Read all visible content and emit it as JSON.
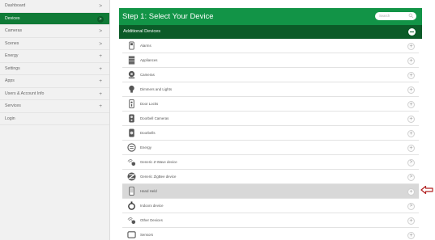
{
  "sidebar": {
    "items": [
      {
        "label": "Dashboard",
        "symbol": ">",
        "active": false
      },
      {
        "label": "Devices",
        "symbol": ">",
        "active": true
      },
      {
        "label": "Cameras",
        "symbol": ">",
        "active": false
      },
      {
        "label": "Scenes",
        "symbol": ">",
        "active": false
      },
      {
        "label": "Energy",
        "symbol": "+",
        "active": false
      },
      {
        "label": "Settings",
        "symbol": "+",
        "active": false
      },
      {
        "label": "Apps",
        "symbol": "+",
        "active": false
      },
      {
        "label": "Users & Account Info",
        "symbol": "+",
        "active": false
      },
      {
        "label": "Services",
        "symbol": "+",
        "active": false
      },
      {
        "label": "Login",
        "symbol": "",
        "active": false
      }
    ]
  },
  "header": {
    "step_title": "Step 1: Select Your Device",
    "search_placeholder": "Search"
  },
  "section": {
    "title": "Additional Devices"
  },
  "devices": [
    {
      "label": "Alarms",
      "icon": "alarm-icon",
      "action": "+",
      "highlight": false
    },
    {
      "label": "Appliances",
      "icon": "appliance-icon",
      "action": "+",
      "highlight": false
    },
    {
      "label": "Cameras",
      "icon": "camera-icon",
      "action": "+",
      "highlight": false
    },
    {
      "label": "Dimmers and Lights",
      "icon": "lightbulb-icon",
      "action": "+",
      "highlight": false
    },
    {
      "label": "Door Locks",
      "icon": "door-lock-icon",
      "action": "+",
      "highlight": false
    },
    {
      "label": "Doorbell Cameras",
      "icon": "doorbell-camera-icon",
      "action": "+",
      "highlight": false
    },
    {
      "label": "Doorbells",
      "icon": "doorbell-icon",
      "action": "+",
      "highlight": false
    },
    {
      "label": "Energy",
      "icon": "energy-meter-icon",
      "action": "+",
      "highlight": false
    },
    {
      "label": "Generic Z-Wave device",
      "icon": "zwave-icon",
      "action": ">",
      "highlight": false
    },
    {
      "label": "Generic ZigBee device",
      "icon": "zigbee-icon",
      "action": ">",
      "highlight": false
    },
    {
      "label": "Hand Held",
      "icon": "handheld-icon",
      "action": "+",
      "highlight": true
    },
    {
      "label": "Indoorx device",
      "icon": "indoor-device-icon",
      "action": ">",
      "highlight": false
    },
    {
      "label": "Other Devices",
      "icon": "other-devices-icon",
      "action": "+",
      "highlight": false
    },
    {
      "label": "Sensors",
      "icon": "sensor-icon",
      "action": "+",
      "highlight": false
    }
  ],
  "colors": {
    "header_green": "#129447",
    "section_green": "#0b5b28",
    "sidebar_active": "#0f7a36",
    "pointer_red": "#b22222"
  }
}
